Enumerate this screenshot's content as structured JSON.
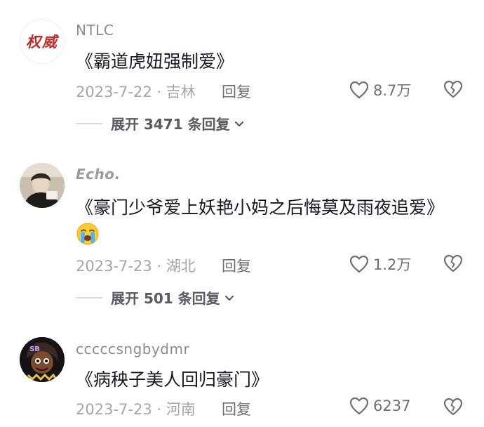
{
  "comments": [
    {
      "username": "NTLC",
      "avatar_text": "权威",
      "text": "《霸道虎妞强制爱》",
      "date_location": "2023-7-22 · 吉林",
      "reply_label": "回复",
      "likes": "8.7万",
      "expand_label": "展开 3471 条回复"
    },
    {
      "username": "Echo.",
      "text": "《豪门少爷爱上妖艳小妈之后悔莫及雨夜追爱》",
      "emoji": "loudly-crying-face",
      "date_location": "2023-7-23 · 湖北",
      "reply_label": "回复",
      "likes": "1.2万",
      "expand_label": "展开 501 条回复"
    },
    {
      "username": "cccccsngbydmr",
      "text": "《病秧子美人回归豪门》",
      "date_location": "2023-7-23 · 河南",
      "reply_label": "回复",
      "likes": "6237"
    }
  ],
  "colors": {
    "text": "#161823",
    "secondary": "#a4a5aa",
    "avatar_seal": "#c62b2b"
  },
  "icons": [
    "heart-outline-icon",
    "broken-heart-icon",
    "chevron-down-icon"
  ]
}
